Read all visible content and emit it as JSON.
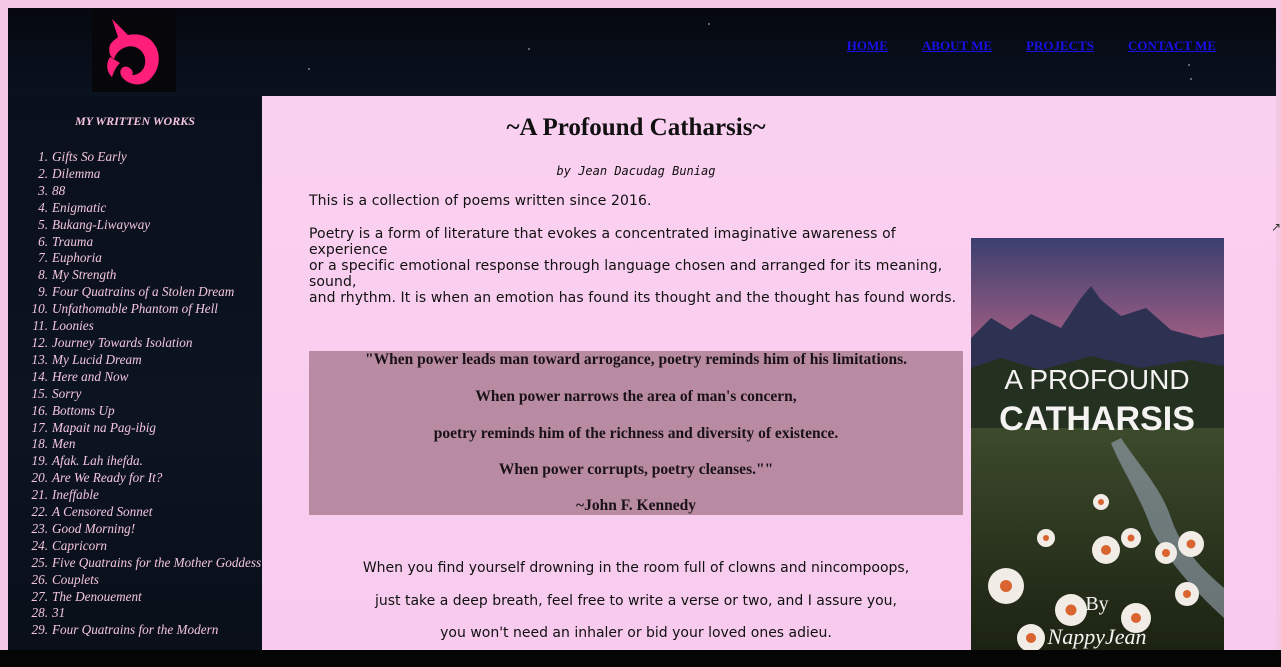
{
  "nav": {
    "items": [
      "HOME",
      "ABOUT ME",
      "PROJECTS",
      "CONTACT ME"
    ]
  },
  "sidebar": {
    "heading": "MY WRITTEN WORKS",
    "works": [
      "Gifts So Early",
      "Dilemma",
      "88",
      "Enigmatic",
      "Bukang-Liwayway",
      "Trauma",
      "Euphoria",
      "My Strength",
      "Four Quatrains of a Stolen Dream",
      "Unfathomable Phantom of Hell",
      "Loonies",
      "Journey Towards Isolation",
      "My Lucid Dream",
      "Here and Now",
      "Sorry",
      "Bottoms Up",
      "Mapait na Pag-ibig",
      "Men",
      "Afak. Lah ihefda.",
      "Are We Ready for It?",
      "Ineffable",
      "A Censored Sonnet",
      "Good Morning!",
      "Capricorn",
      "Five Quatrains for the Mother Goddess",
      "Couplets",
      "The Denouement",
      "31",
      "Four Quatrains for the Modern"
    ]
  },
  "main": {
    "title": "~A Profound Catharsis~",
    "byline": "by Jean Dacudag Buniag",
    "intro": "This is a collection of poems written since 2016.",
    "description": [
      "Poetry is a form of literature that evokes a concentrated imaginative awareness of experience",
      "or a specific emotional response through language chosen and arranged for its meaning, sound,",
      "and rhythm. It is when an emotion has found its thought and the thought has found words."
    ],
    "quote": [
      "\"When power leads man toward arrogance, poetry reminds him of his limitations.",
      "When power narrows the area of man's concern,",
      "poetry reminds him of the richness and diversity of existence.",
      "When power corrupts, poetry cleanses.\"\"",
      "~John F. Kennedy"
    ],
    "verse": [
      "When you find yourself drowning in the room full of clowns and nincompoops,",
      "just take a deep breath, feel free to write a verse or two, and I assure you,",
      "you won't need an inhaler or bid your loved ones adieu."
    ]
  },
  "cover": {
    "line1": "A PROFOUND",
    "line2": "CATHARSIS",
    "by": "By",
    "author": "NappyJean"
  },
  "colors": {
    "page_bg": "#f3c8e4",
    "header_bg": "#05080f",
    "sidebar_text": "#f3c4df",
    "link": "#1a10e8",
    "quote_bg": "#b88ba3",
    "logo_pink": "#ff1f7a"
  },
  "icons": {
    "logo": "unicorn-logo-icon"
  }
}
